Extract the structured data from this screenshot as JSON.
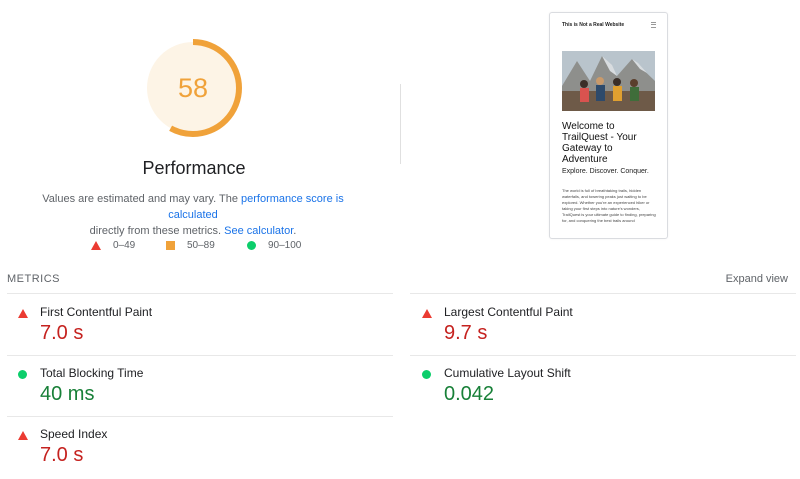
{
  "performance": {
    "score": "58",
    "score_fraction": 0.58,
    "title": "Performance",
    "description_prefix": "Values are estimated and may vary. The ",
    "link_score": "performance score is calculated",
    "description_mid": " directly from these metrics. ",
    "link_calculator": "See calculator",
    "description_suffix": "."
  },
  "legend": [
    {
      "icon": "red-triangle-icon",
      "range": "0–49"
    },
    {
      "icon": "orange-square-icon",
      "range": "50–89"
    },
    {
      "icon": "green-circle-icon",
      "range": "90–100"
    }
  ],
  "preview": {
    "site_header": "This is Not a Real Website",
    "heading": "Welcome to TrailQuest - Your Gateway to Adventure",
    "tagline": "Explore. Discover. Conquer.",
    "body": "The world is full of breathtaking trails, hidden waterfalls, and towering peaks just waiting to be explored. Whether you're an experienced hiker or taking your first steps into nature's wonders, TrailQuest is your ultimate guide to finding, preparing for, and conquering the best trails around"
  },
  "metrics": {
    "section_label": "METRICS",
    "expand_label": "Expand view",
    "items": [
      {
        "name": "First Contentful Paint",
        "value": "7.0 s",
        "status": "red"
      },
      {
        "name": "Largest Contentful Paint",
        "value": "9.7 s",
        "status": "red"
      },
      {
        "name": "Total Blocking Time",
        "value": "40 ms",
        "status": "green"
      },
      {
        "name": "Cumulative Layout Shift",
        "value": "0.042",
        "status": "green"
      },
      {
        "name": "Speed Index",
        "value": "7.0 s",
        "status": "red"
      }
    ]
  },
  "colors": {
    "average": "#f0a23a",
    "fail": "#eb3b32",
    "pass": "#0cce6b",
    "link": "#1a73e8"
  }
}
